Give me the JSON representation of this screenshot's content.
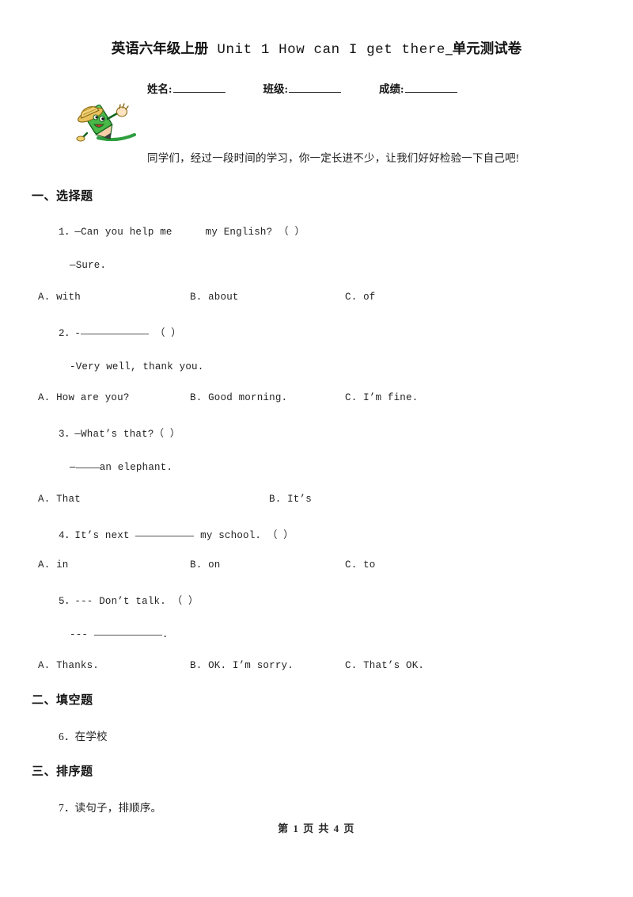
{
  "document": {
    "title_cn_prefix": "英语六年级上册",
    "title_en": " Unit 1 How can I get there",
    "title_cn_suffix": "_单元测试卷",
    "greeting": "同学们，经过一段时间的学习，你一定长进不少，让我们好好检验一下自己吧!",
    "mascot_icon": "green-pencil-mascot-icon"
  },
  "info": {
    "name_label": "姓名:",
    "class_label": "班级:",
    "score_label": "成绩:"
  },
  "sections": [
    {
      "heading": "一、选择题"
    },
    {
      "heading": "二、填空题"
    },
    {
      "heading": "三、排序题"
    }
  ],
  "questions": {
    "q1": {
      "stem": "1．—Can you help me",
      "stem_tail": "my English? （    ）",
      "answer_line": "—Sure.",
      "options": [
        "A. with",
        "B. about",
        "C. of"
      ]
    },
    "q2": {
      "stem_prefix": "2．-",
      "stem_tail": "（    ）",
      "answer_line": "-Very well, thank you.",
      "options": [
        "A. How are you?",
        "B. Good morning.",
        "C. I’m fine."
      ]
    },
    "q3": {
      "stem": "3．—What’s that?（    ）",
      "answer_prefix": "—",
      "answer_tail": "an elephant.",
      "options": [
        "A. That",
        "B. It’s"
      ]
    },
    "q4": {
      "stem_prefix": "4．It’s next ",
      "stem_tail": " my school. （    ）",
      "options": [
        "A. in",
        "B. on",
        "C. to"
      ]
    },
    "q5": {
      "stem": "5．--- Don’t talk. （    ）",
      "answer_prefix": "--- ",
      "answer_tail": ".",
      "options": [
        "A. Thanks.",
        "B. OK. I’m sorry.",
        "C. That’s OK."
      ]
    },
    "q6": {
      "stem": "6．在学校"
    },
    "q7": {
      "stem": "7．读句子，排顺序。"
    }
  },
  "footer": {
    "page_info": "第 1 页 共 4 页"
  }
}
